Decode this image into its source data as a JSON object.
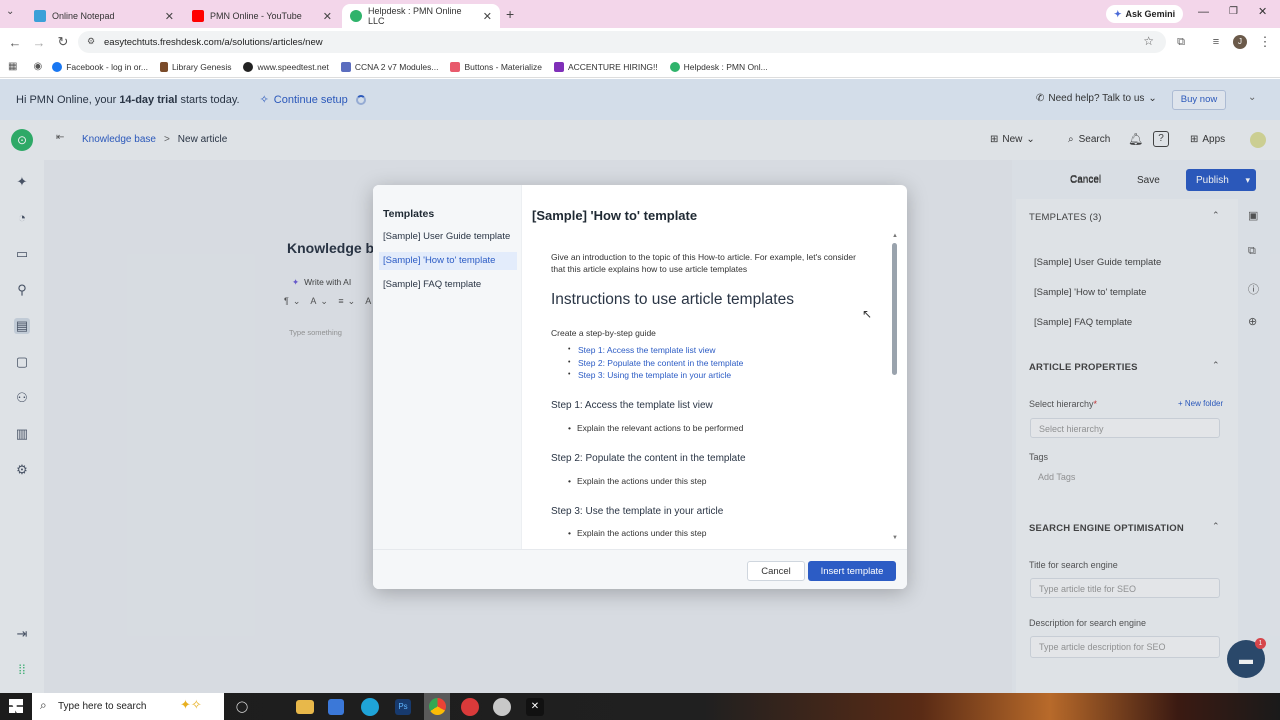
{
  "browser": {
    "tabs": [
      {
        "title": "Online Notepad",
        "active": false,
        "color": "#3aa0d8"
      },
      {
        "title": "PMN Online - YouTube",
        "active": false,
        "color": "#ff0000"
      },
      {
        "title": "Helpdesk : PMN Online LLC",
        "active": true,
        "color": "#2fb36b"
      }
    ],
    "new_tab": "+",
    "ask_gemini": "Ask Gemini",
    "url": "easytechtuts.freshdesk.com/a/solutions/articles/new",
    "bookmarks": [
      {
        "label": "Facebook - log in or...",
        "color": "#1877f2"
      },
      {
        "label": "Library Genesis",
        "color": "#7a4b2a"
      },
      {
        "label": "www.speedtest.net",
        "color": "#222"
      },
      {
        "label": "CCNA 2 v7 Modules...",
        "color": "#5b6dbf"
      },
      {
        "label": "Buttons - Materialize",
        "color": "#e85a6c"
      },
      {
        "label": "ACCENTURE HIRING!!",
        "color": "#7f2fb8"
      },
      {
        "label": "Helpdesk : PMN Onl...",
        "color": "#2fb36b"
      }
    ],
    "profile_initial": "J"
  },
  "trial": {
    "text_prefix": "Hi PMN Online, your ",
    "text_bold": "14-day trial",
    "text_suffix": " starts today.",
    "continue_setup": "Continue setup",
    "need_help": "Need help? Talk to us",
    "buy_now": "Buy now"
  },
  "topnav": {
    "breadcrumb_1": "Knowledge base",
    "breadcrumb_sep": ">",
    "breadcrumb_2": "New article",
    "new_label": "New",
    "search_label": "Search",
    "apps_label": "Apps"
  },
  "editor": {
    "title_partial": "Knowledge b",
    "write_ai": "Write with AI",
    "placeholder": "Type something",
    "cancel": "Cancel",
    "save": "Save",
    "publish": "Publish"
  },
  "right_panel": {
    "templates_header": "TEMPLATES (3)",
    "templates": [
      "[Sample] User Guide template",
      "[Sample] 'How to' template",
      "[Sample] FAQ template"
    ],
    "article_properties": "ARTICLE PROPERTIES",
    "select_hierarchy_label": "Select hierarchy",
    "required_mark": "*",
    "new_folder": "+ New folder",
    "select_hierarchy_placeholder": "Select hierarchy",
    "tags_label": "Tags",
    "tags_placeholder": "Add Tags",
    "seo_header": "SEARCH ENGINE OPTIMISATION",
    "seo_title_label": "Title for search engine",
    "seo_title_placeholder": "Type article title for SEO",
    "seo_desc_label": "Description for search engine",
    "seo_desc_placeholder": "Type article description for SEO",
    "chat_badge": "1"
  },
  "modal": {
    "sidebar_title": "Templates",
    "templates": [
      "[Sample] User Guide template",
      "[Sample] 'How to' template",
      "[Sample] FAQ template"
    ],
    "selected_index": 1,
    "preview_title": "[Sample] 'How to' template",
    "intro": "Give an introduction to the topic of this How-to article. For example, let's consider that this article explains how to use article templates",
    "heading": "Instructions to use article templates",
    "guide_label": "Create a step-by-step guide",
    "toc": [
      "Step 1: Access the template list view",
      "Step 2: Populate the content in the template",
      "Step 3: Using the template in your article"
    ],
    "steps": [
      {
        "title": "Step 1: Access the template list view",
        "bullet": "Explain the relevant actions to be performed"
      },
      {
        "title": "Step 2: Populate the content in the template",
        "bullet": "Explain the actions under this step"
      },
      {
        "title": "Step 3: Use the template in your article",
        "bullet": "Explain the actions under this step"
      }
    ],
    "cancel": "Cancel",
    "insert": "Insert template"
  },
  "taskbar": {
    "search_placeholder": "Type here to search"
  },
  "colors": {
    "primary": "#2c5cc5",
    "selected_bg": "#e3ecfb",
    "trial_bg": "#e2ecf8"
  }
}
